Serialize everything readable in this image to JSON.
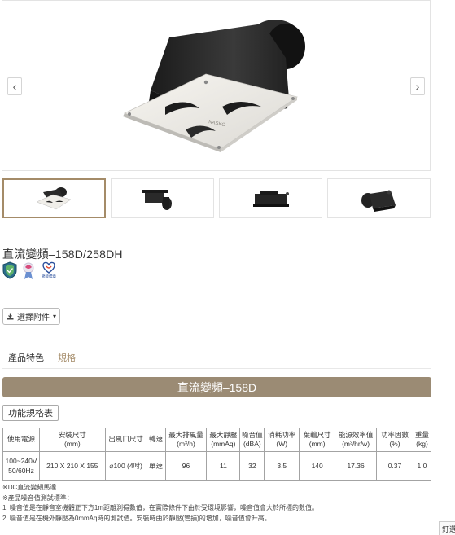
{
  "gallery": {
    "prev_icon": "chevron-left",
    "next_icon": "chevron-right",
    "prev_glyph": "‹",
    "next_glyph": "›",
    "brand_text": "NASKO"
  },
  "thumbnails": [
    {
      "name": "thumb-front",
      "active": true
    },
    {
      "name": "thumb-side",
      "active": false
    },
    {
      "name": "thumb-back",
      "active": false
    },
    {
      "name": "thumb-angle",
      "active": false
    }
  ],
  "product": {
    "title": "直流變頻–158D/258DH",
    "badges": [
      "shield-badge",
      "award-badge",
      "energy-label-badge"
    ],
    "energy_label_text": "節能標章"
  },
  "accessory_button": {
    "icon": "download-icon",
    "label": "選擇附件",
    "caret": "▾"
  },
  "tabs": {
    "features": "產品特色",
    "specs": "規格"
  },
  "model_bar": "直流變頻–158D",
  "spec_button": "功能規格表",
  "table": {
    "headers": [
      [
        "使用電源"
      ],
      [
        "安裝尺寸",
        "(mm)"
      ],
      [
        "出風口尺寸"
      ],
      [
        "轉速"
      ],
      [
        "最大排風量",
        "(m³/h)"
      ],
      [
        "最大靜壓",
        "(mmAq)"
      ],
      [
        "噪音值",
        "(dBA)"
      ],
      [
        "消耗功率",
        "(W)"
      ],
      [
        "葉輪尺寸",
        "(mm)"
      ],
      [
        "能源效率值",
        "(m³/hr/w)"
      ],
      [
        "功率因數",
        "(%)"
      ],
      [
        "重量",
        "(kg)"
      ]
    ],
    "row": [
      [
        "100~240V",
        "50/60Hz"
      ],
      [
        "210 X 210 X 155"
      ],
      [
        "⌀100 (4吋)"
      ],
      [
        "單速"
      ],
      [
        "96"
      ],
      [
        "11"
      ],
      [
        "32"
      ],
      [
        "3.5"
      ],
      [
        "140"
      ],
      [
        "17.36"
      ],
      [
        "0.37"
      ],
      [
        "1.0"
      ]
    ]
  },
  "notes": [
    "※DC直流變頻馬達",
    "※產品噪音值測試標準：",
    "1. 噪音值是在靜音室機體正下方1m距離測得數值，在實際條件下由於受環境影響，噪音值會大於所標的數值。",
    "2. 噪音值是在機外靜壓為0mmAq時的測試值。安裝時由於靜壓(管損)的增加，噪音值會升高。"
  ],
  "floating_tab": "釘選"
}
